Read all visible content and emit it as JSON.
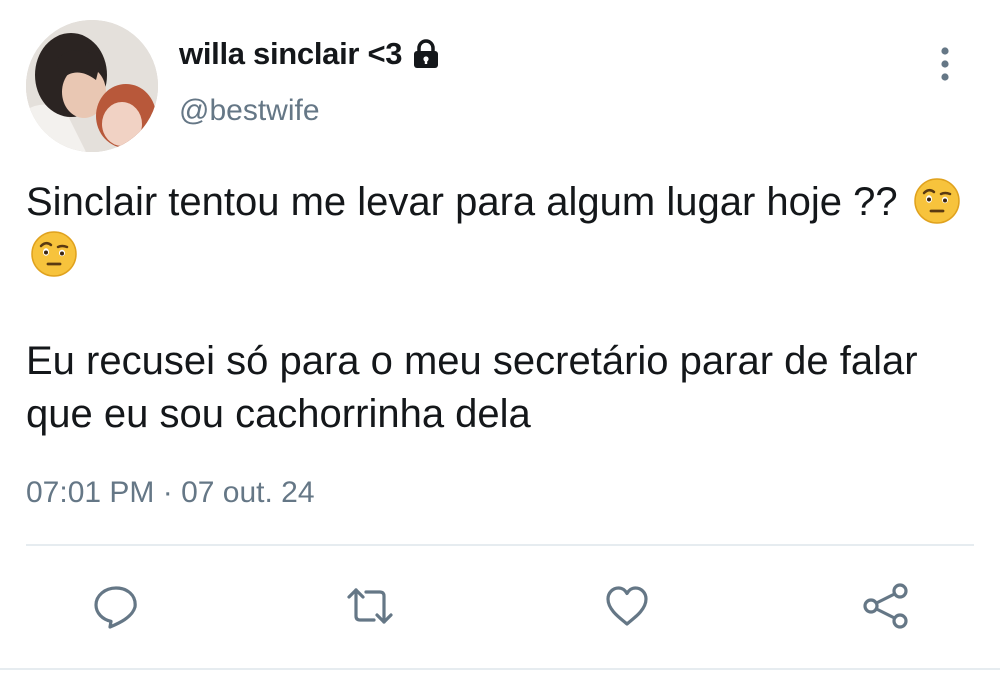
{
  "tweet": {
    "display_name": "willa sinclair <3",
    "handle": "@bestwife",
    "protected_icon": "lock-icon",
    "paragraph_1": "Sinclair tentou me levar para algum lugar hoje ??",
    "paragraph_1_emojis": [
      "face-with-raised-eyebrow-emoji",
      "face-with-raised-eyebrow-emoji"
    ],
    "paragraph_2": "Eu recusei só para o meu secretário parar de falar que eu sou cachorrinha dela",
    "timestamp": "07:01 PM · 07 out. 24"
  },
  "actions": {
    "reply_icon": "reply-icon",
    "retweet_icon": "retweet-icon",
    "like_icon": "heart-icon",
    "share_icon": "share-icon",
    "more_icon": "more-vertical-icon"
  },
  "colors": {
    "text": "#14171a",
    "secondary": "#657786",
    "divider": "#e6ecf0",
    "action_icon": "#657786"
  }
}
